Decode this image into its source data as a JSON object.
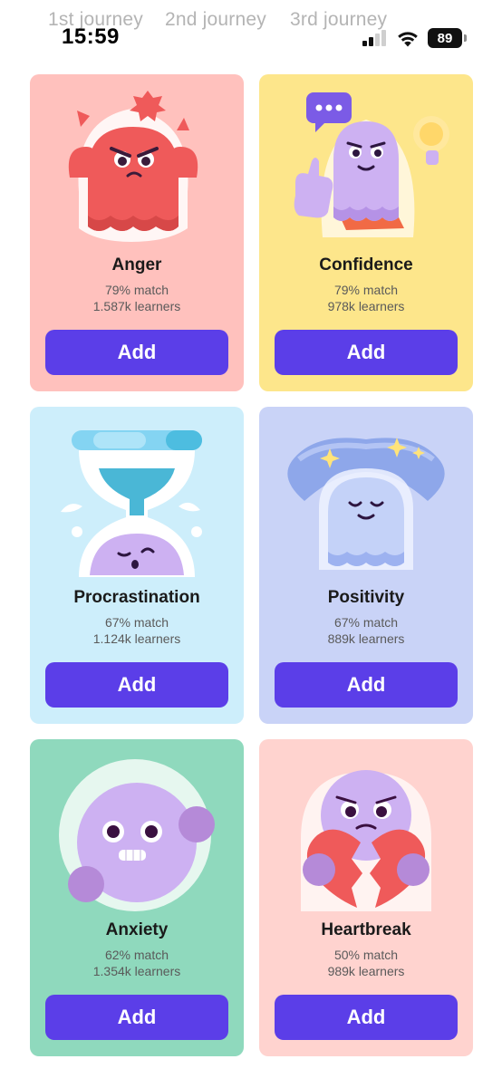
{
  "status_bar": {
    "time": "15:59",
    "battery": "89",
    "icons": [
      "cellular-signal-icon",
      "wifi-icon",
      "battery-icon"
    ]
  },
  "journey_tabs": [
    "1st journey",
    "2nd journey",
    "3rd journey"
  ],
  "colors": {
    "accent": "#5b3ee8",
    "anger_bg": "#ffc1bd",
    "confidence_bg": "#fde68b",
    "procrastination_bg": "#cdeefb",
    "positivity_bg": "#c9d3f7",
    "anxiety_bg": "#8fd9bd",
    "heartbreak_bg": "#ffd3cf"
  },
  "cards": [
    {
      "title": "Anger",
      "match": "79% match",
      "learners": "1.587k learners",
      "button": "Add",
      "illustration": "angry-ghost-icon"
    },
    {
      "title": "Confidence",
      "match": "79% match",
      "learners": "978k learners",
      "button": "Add",
      "illustration": "confident-ghost-icon"
    },
    {
      "title": "Procrastination",
      "match": "67% match",
      "learners": "1.124k learners",
      "button": "Add",
      "illustration": "hourglass-icon"
    },
    {
      "title": "Positivity",
      "match": "67% match",
      "learners": "889k learners",
      "button": "Add",
      "illustration": "calm-ghost-icon"
    },
    {
      "title": "Anxiety",
      "match": "62% match",
      "learners": "1.354k learners",
      "button": "Add",
      "illustration": "anxious-face-icon"
    },
    {
      "title": "Heartbreak",
      "match": "50% match",
      "learners": "989k learners",
      "button": "Add",
      "illustration": "broken-heart-icon"
    }
  ]
}
